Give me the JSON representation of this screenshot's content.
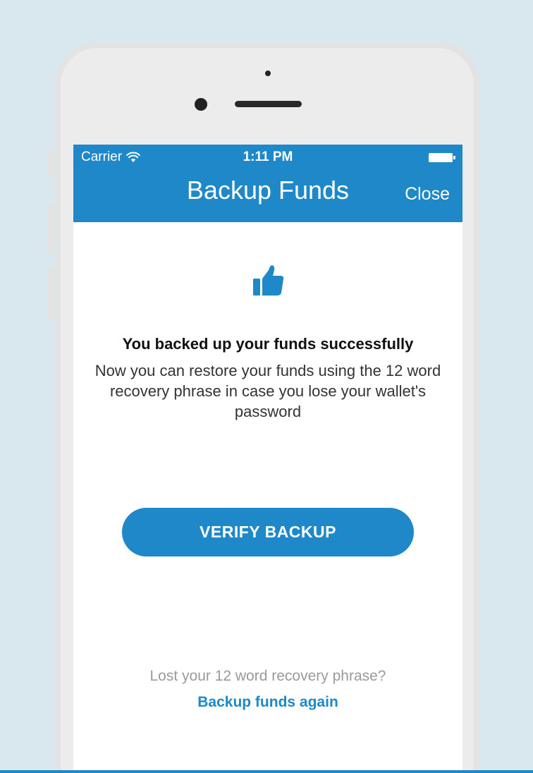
{
  "status_bar": {
    "carrier": "Carrier",
    "time": "1:11 PM",
    "icons": [
      "wifi-icon",
      "battery-icon"
    ]
  },
  "header": {
    "title": "Backup Funds",
    "close_label": "Close"
  },
  "main": {
    "icon": "thumbs-up-icon",
    "success_title": "You backed up your funds successfully",
    "success_description": "Now you can restore your funds using the 12 word recovery phrase in case you lose your wallet's password",
    "verify_button_label": "VERIFY BACKUP",
    "lost_phrase_text": "Lost your 12 word recovery phrase?",
    "backup_again_link": "Backup funds again"
  },
  "colors": {
    "accent": "#1e88c8",
    "background": "#d9e7ee",
    "phone_frame": "#ececec"
  }
}
